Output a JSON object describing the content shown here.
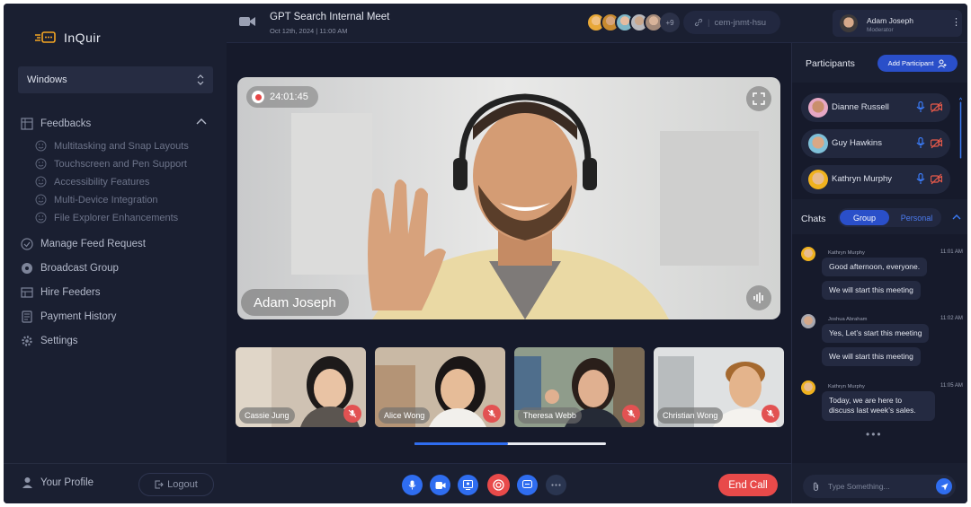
{
  "app": {
    "name": "InQuir"
  },
  "sidebar": {
    "workspace": "Windows",
    "feedbacks": {
      "label": "Feedbacks",
      "items": [
        "Multitasking and Snap Layouts",
        "Touchscreen and Pen Support",
        "Accessibility Features",
        "Multi-Device Integration",
        "File Explorer Enhancements"
      ]
    },
    "nav": [
      "Manage Feed Request",
      "Broadcast Group",
      "Hire Feeders",
      "Payment History",
      "Settings"
    ],
    "profile": "Your Profile",
    "logout": "Logout"
  },
  "header": {
    "meeting_title": "GPT Search Internal Meet",
    "meeting_date": "Oct 12th, 2024 | 11:00 AM",
    "more_count": "+9",
    "meet_code": "cem-jnmt-hsu",
    "user_name": "Adam Joseph",
    "user_role": "Moderator"
  },
  "video": {
    "timer": "24:01:45",
    "speaker": "Adam Joseph"
  },
  "thumbnails": [
    "Cassie Jung",
    "Alice Wong",
    "Theresa Webb",
    "Christian Wong"
  ],
  "thumb_scroll_fraction": 0.49,
  "controls": {
    "end_call": "End Call"
  },
  "participants": {
    "title": "Participants",
    "add_label": "Add Participant",
    "list": [
      "Dianne Russell",
      "Guy Hawkins",
      "Kathryn Murphy"
    ]
  },
  "chats": {
    "title": "Chats",
    "tab_group": "Group",
    "tab_personal": "Personal",
    "messages": [
      {
        "name": "Kathryn Murphy",
        "time": "11:01 AM",
        "lines": [
          "Good afternoon, everyone.",
          "We will start this meeting"
        ]
      },
      {
        "name": "Joshua Abraham",
        "time": "11:02 AM",
        "lines": [
          "Yes, Let’s start this meeting",
          "We will start this meeting"
        ]
      },
      {
        "name": "Kathryn Murphy",
        "time": "11:05 AM",
        "lines": [
          "Today, we are here to discuss last week’s sales."
        ]
      }
    ],
    "input_placeholder": "Type Something..."
  },
  "colors": {
    "accent": "#2f6df0",
    "danger": "#e84a4a",
    "panel": "#1a1f31",
    "background": "#161a2b"
  }
}
